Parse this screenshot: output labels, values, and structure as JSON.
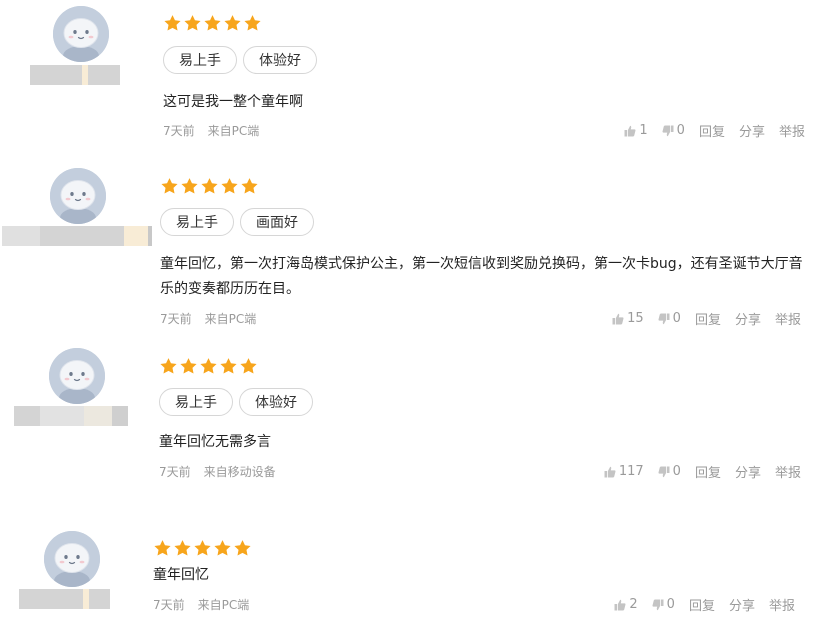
{
  "reviews": [
    {
      "rating": 5,
      "tags": [
        "易上手",
        "体验好"
      ],
      "content": "这可是我一整个童年啊",
      "time": "7天前",
      "source": "来自PC端",
      "likes": "1",
      "dislikes": "0",
      "reply_label": "回复",
      "share_label": "分享",
      "report_label": "举报"
    },
    {
      "rating": 5,
      "tags": [
        "易上手",
        "画面好"
      ],
      "content": "童年回忆，第一次打海岛模式保护公主，第一次短信收到奖励兑换码，第一次卡bug，还有圣诞节大厅音乐的变奏都历历在目。",
      "time": "7天前",
      "source": "来自PC端",
      "likes": "15",
      "dislikes": "0",
      "reply_label": "回复",
      "share_label": "分享",
      "report_label": "举报"
    },
    {
      "rating": 5,
      "tags": [
        "易上手",
        "体验好"
      ],
      "content": "童年回忆无需多言",
      "time": "7天前",
      "source": "来自移动设备",
      "likes": "117",
      "dislikes": "0",
      "reply_label": "回复",
      "share_label": "分享",
      "report_label": "举报"
    },
    {
      "rating": 5,
      "tags": [],
      "content": "童年回忆",
      "time": "7天前",
      "source": "来自PC端",
      "likes": "2",
      "dislikes": "0",
      "reply_label": "回复",
      "share_label": "分享",
      "report_label": "举报"
    }
  ],
  "colors": {
    "star": "#f7a51c",
    "avatar_bg": "#c3cedd",
    "meta_text": "#9a9a9a",
    "tag_border": "#d6d6d6",
    "name_blur_gray": "#d4d4d4",
    "name_blur_light": "#ece8df",
    "name_blur_cream": "#f8ecd6"
  },
  "icons": {
    "like": "thumbs-up-icon",
    "dislike": "thumbs-down-icon",
    "star": "star-icon",
    "avatar": "default-avatar-icon"
  }
}
